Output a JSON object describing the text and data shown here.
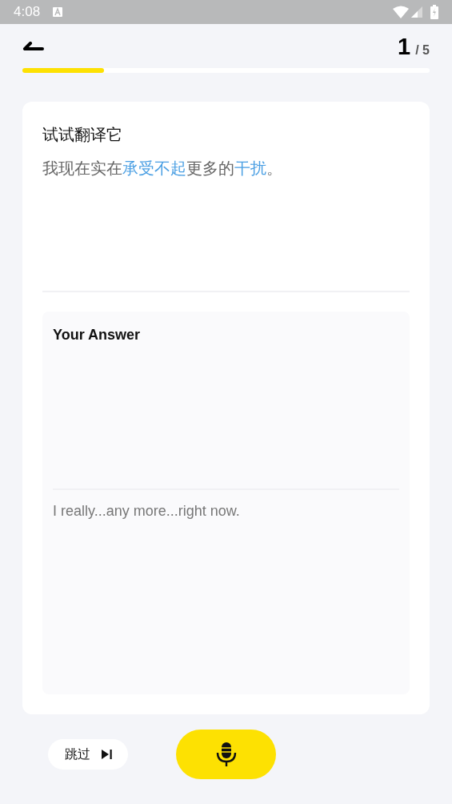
{
  "status_bar": {
    "time": "4:08"
  },
  "progress": {
    "current": "1",
    "total": "/ 5",
    "level": 0.2
  },
  "prompt": {
    "title": "试试翻译它",
    "segments": [
      {
        "text": "我现在实在",
        "highlight": false
      },
      {
        "text": "承受不起",
        "highlight": true
      },
      {
        "text": "更多的",
        "highlight": false
      },
      {
        "text": "干扰",
        "highlight": true
      },
      {
        "text": "。",
        "highlight": false
      }
    ]
  },
  "answer": {
    "label": "Your Answer",
    "placeholder": "I really...any more...right now."
  },
  "skip_button": {
    "label": "跳过"
  }
}
